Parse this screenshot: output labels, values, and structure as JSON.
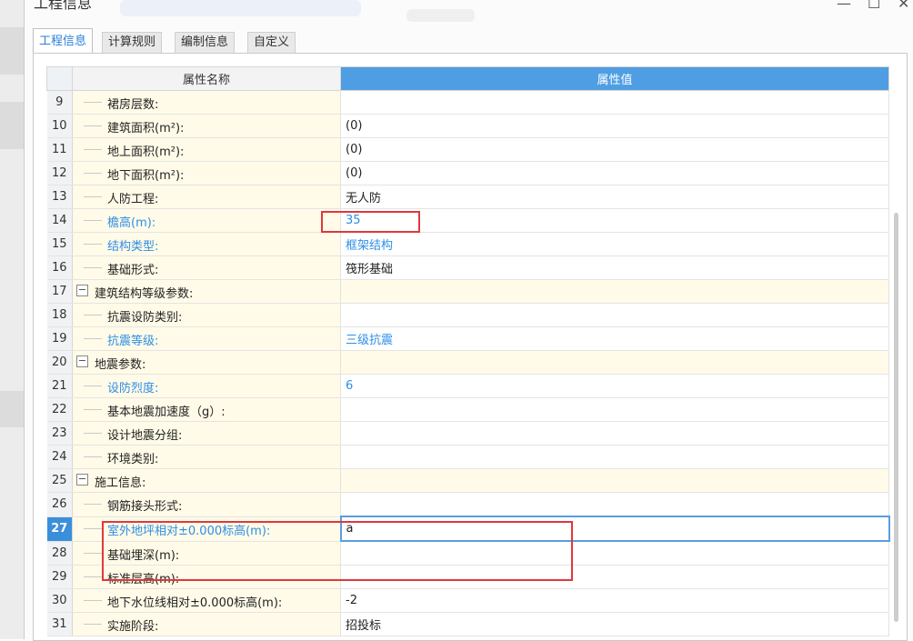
{
  "window": {
    "title": "工程信息",
    "minimize": "—",
    "maximize": "☐",
    "close": "✕"
  },
  "tabs": [
    {
      "label": "工程信息",
      "active": true
    },
    {
      "label": "计算规则",
      "active": false
    },
    {
      "label": "编制信息",
      "active": false
    },
    {
      "label": "自定义",
      "active": false
    }
  ],
  "table": {
    "header_name": "属性名称",
    "header_value": "属性值",
    "rows": [
      {
        "num": "9",
        "name": "裙房层数:",
        "value": "",
        "group": false,
        "highlight": false
      },
      {
        "num": "10",
        "name": "建筑面积(m²):",
        "value": "(0)",
        "group": false,
        "highlight": false
      },
      {
        "num": "11",
        "name": "地上面积(m²):",
        "value": "(0)",
        "group": false,
        "highlight": false
      },
      {
        "num": "12",
        "name": "地下面积(m²):",
        "value": "(0)",
        "group": false,
        "highlight": false
      },
      {
        "num": "13",
        "name": "人防工程:",
        "value": "无人防",
        "group": false,
        "highlight": false
      },
      {
        "num": "14",
        "name": "檐高(m):",
        "value": "35",
        "group": false,
        "highlight": true
      },
      {
        "num": "15",
        "name": "结构类型:",
        "value": "框架结构",
        "group": false,
        "highlight": true
      },
      {
        "num": "16",
        "name": "基础形式:",
        "value": "筏形基础",
        "group": false,
        "highlight": false
      },
      {
        "num": "17",
        "name": "建筑结构等级参数:",
        "value": "",
        "group": true,
        "highlight": false
      },
      {
        "num": "18",
        "name": "抗震设防类别:",
        "value": "",
        "group": false,
        "highlight": false
      },
      {
        "num": "19",
        "name": "抗震等级:",
        "value": "三级抗震",
        "group": false,
        "highlight": true
      },
      {
        "num": "20",
        "name": "地震参数:",
        "value": "",
        "group": true,
        "highlight": false
      },
      {
        "num": "21",
        "name": "设防烈度:",
        "value": "6",
        "group": false,
        "highlight": true
      },
      {
        "num": "22",
        "name": "基本地震加速度（g）:",
        "value": "",
        "group": false,
        "highlight": false
      },
      {
        "num": "23",
        "name": "设计地震分组:",
        "value": "",
        "group": false,
        "highlight": false
      },
      {
        "num": "24",
        "name": "环境类别:",
        "value": "",
        "group": false,
        "highlight": false
      },
      {
        "num": "25",
        "name": "施工信息:",
        "value": "",
        "group": true,
        "highlight": false
      },
      {
        "num": "26",
        "name": "钢筋接头形式:",
        "value": "",
        "group": false,
        "highlight": false
      },
      {
        "num": "27",
        "name": "室外地坪相对±0.000标高(m):",
        "value": "a",
        "group": false,
        "highlight": true,
        "selected": true
      },
      {
        "num": "28",
        "name": "基础埋深(m):",
        "value": "",
        "group": false,
        "highlight": false
      },
      {
        "num": "29",
        "name": "标准层高(m):",
        "value": "",
        "group": false,
        "highlight": false
      },
      {
        "num": "30",
        "name": "地下水位线相对±0.000标高(m):",
        "value": "-2",
        "group": false,
        "highlight": false
      },
      {
        "num": "31",
        "name": "实施阶段:",
        "value": "招投标",
        "group": false,
        "highlight": false
      }
    ]
  },
  "colors": {
    "accent": "#4f9ee3",
    "highlight_text": "#2e8ee6",
    "name_column_bg": "#fffbe8",
    "annotation_red": "#e0383b"
  }
}
